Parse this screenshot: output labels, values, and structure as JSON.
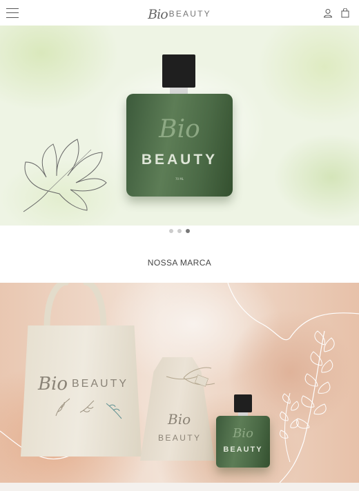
{
  "header": {
    "logo_script": "Bio",
    "logo_text": "BEAUTY",
    "menu_icon": "menu-icon",
    "account_icon": "user-icon",
    "cart_icon": "shopping-bag-icon"
  },
  "hero": {
    "bottle_script": "Bio",
    "bottle_label": "BEAUTY",
    "bottle_volume": "70 ML",
    "slides_total": 3,
    "active_slide": 3
  },
  "section": {
    "title": "NOSSA MARCA"
  },
  "brand_banner": {
    "tote_script": "Bio",
    "tote_label": "BEAUTY",
    "pouch_script": "Bio",
    "pouch_label": "BEAUTY",
    "bottle_script": "Bio",
    "bottle_label": "BEAUTY"
  },
  "colors": {
    "accent_dark": "#444444",
    "bottle_green": "#4b6a46",
    "dot_active": "#777777",
    "dot_inactive": "#cccccc"
  }
}
